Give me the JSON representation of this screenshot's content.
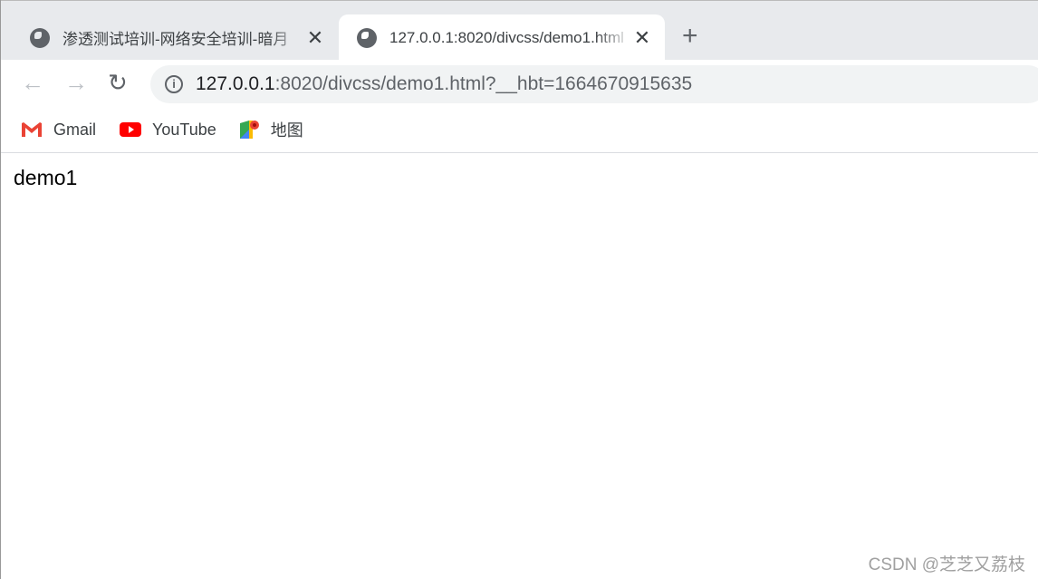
{
  "tabs": [
    {
      "title": "渗透测试培训-网络安全培训-暗月",
      "active": false
    },
    {
      "title": "127.0.0.1:8020/divcss/demo1.html",
      "active": true
    }
  ],
  "toolbar": {
    "url_host": "127.0.0.1",
    "url_rest": ":8020/divcss/demo1.html?__hbt=1664670915635"
  },
  "bookmarks": [
    {
      "label": "Gmail"
    },
    {
      "label": "YouTube"
    },
    {
      "label": "地图"
    }
  ],
  "page": {
    "text": "demo1"
  },
  "watermark": "CSDN @芝芝又荔枝"
}
